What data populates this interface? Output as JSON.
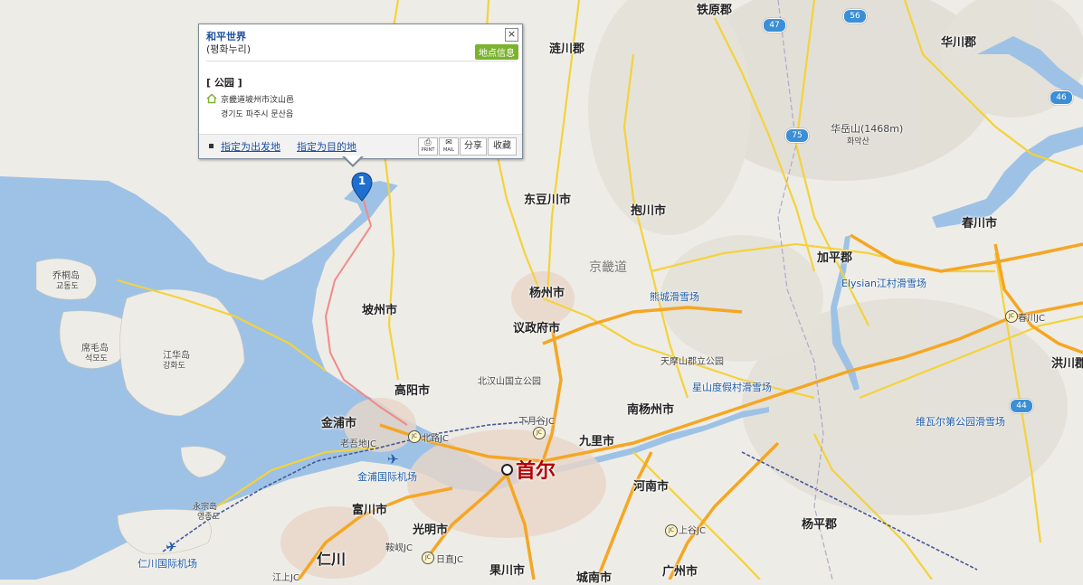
{
  "popup": {
    "title": "和平世界",
    "subtitle": "(평화누리)",
    "close_glyph": "×",
    "badge": "地点信息",
    "category": "[ 公园 ]",
    "address_cn": "京畿道坡州市汶山邑",
    "address_kr": "경기도 파주시 문산읍",
    "set_start": "指定为出发地",
    "set_destination": "指定为目的地",
    "print_label": "PRINT",
    "mail_label": "MAIL",
    "share_label": "分享",
    "favorite_label": "收藏"
  },
  "marker": {
    "number": "1",
    "color": "#1f6fd1"
  },
  "colors": {
    "water": "#9ec2e6",
    "land": "#eeece6",
    "highway": "#f5a623",
    "major_road": "#f4d23c",
    "urban": "#e8d6c8"
  },
  "labels": {
    "tiewon": "铁原郡",
    "lianchuan": "涟川郡",
    "huachuan": "华川郡",
    "huayue": "华岳山(1468m)",
    "huayue_kr": "화악산",
    "dongdouchuan": "东豆川市",
    "baochuan": "抱川市",
    "chunchuan": "春川市",
    "gyeonggi": "京畿道",
    "jiaping": "加平郡",
    "elysian": "Elysian江村滑雪场",
    "xiongcheng": "熊城滑雪场",
    "yangzhou": "杨州市",
    "pozhou": "坡州市",
    "yizhengfu": "议政府市",
    "chunchuan_jc": "春川JC",
    "tianmoshan": "天摩山郡立公园",
    "hongchuan": "洪川郡",
    "xingshandu": "星山度假村滑雪场",
    "beihanshan": "北汉山国立公园",
    "gaoyang": "高阳市",
    "nanyangzhou": "南杨州市",
    "jinpu": "金浦市",
    "xiabugu_jc": "下月谷JC",
    "jiuli": "九里市",
    "weiwaer": "维瓦尔第公园滑雪场",
    "laocao_jc": "老吾地JC",
    "beilu_jc": "北路JC",
    "shouer": "首尔",
    "jinpu_airport": "金浦国际机场",
    "henan": "河南市",
    "yongzong": "永宗岛",
    "yongzong_kr": "영종도",
    "fuchuan": "富川市",
    "guangming": "光明市",
    "shangyi_jc": "上谷JC",
    "yangping": "杨平郡",
    "jiaoyu": "乔桐岛",
    "jiaoyu_kr": "교동도",
    "shimao": "席毛岛",
    "shimao_kr": "석모도",
    "jianghua": "江华岛",
    "jianghua_kr": "강화도",
    "renchuan": "仁川",
    "renchuan_airport": "仁川国际机场",
    "jiaye_jc": "鞍岘JC",
    "riri_jc": "日直JC",
    "guochuan": "果川市",
    "chengnan": "城南市",
    "guangzhou": "广州市",
    "ganglin_jc": "江上JC"
  },
  "shields": {
    "r47": "47",
    "r56": "56",
    "r46": "46",
    "r75": "75",
    "r44": "44"
  },
  "junction_glyph": "JC",
  "airport_glyph": "✈"
}
